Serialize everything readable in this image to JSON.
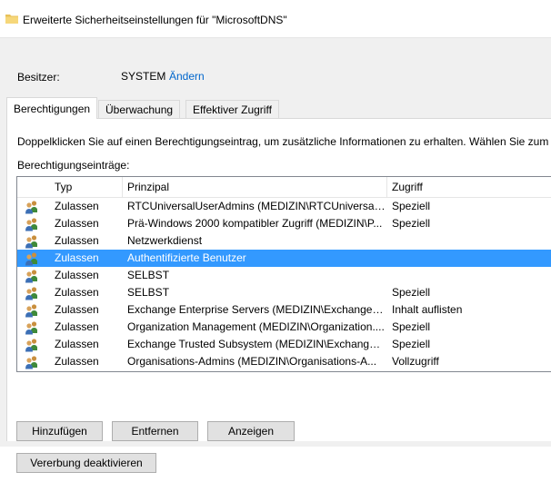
{
  "window": {
    "title": "Erweiterte Sicherheitseinstellungen für \"MicrosoftDNS\""
  },
  "owner": {
    "label": "Besitzer:",
    "value": "SYSTEM",
    "change_link": "Ändern"
  },
  "tabs": [
    {
      "label": "Berechtigungen",
      "active": true
    },
    {
      "label": "Überwachung",
      "active": false
    },
    {
      "label": "Effektiver Zugriff",
      "active": false
    }
  ],
  "permissions": {
    "info_text": "Doppelklicken Sie auf einen Berechtigungseintrag, um zusätzliche Informationen zu erhalten. Wählen Sie zum Ä",
    "entries_label": "Berechtigungseinträge:",
    "columns": {
      "typ": "Typ",
      "prinzipal": "Prinzipal",
      "zugriff": "Zugriff"
    },
    "rows": [
      {
        "typ": "Zulassen",
        "prinzipal": "RTCUniversalUserAdmins (MEDIZIN\\RTCUniversalU...",
        "zugriff": "Speziell",
        "selected": false
      },
      {
        "typ": "Zulassen",
        "prinzipal": "Prä-Windows 2000 kompatibler Zugriff (MEDIZIN\\P...",
        "zugriff": "Speziell",
        "selected": false
      },
      {
        "typ": "Zulassen",
        "prinzipal": "Netzwerkdienst",
        "zugriff": "",
        "selected": false
      },
      {
        "typ": "Zulassen",
        "prinzipal": "Authentifizierte Benutzer",
        "zugriff": "",
        "selected": true
      },
      {
        "typ": "Zulassen",
        "prinzipal": "SELBST",
        "zugriff": "",
        "selected": false
      },
      {
        "typ": "Zulassen",
        "prinzipal": "SELBST",
        "zugriff": "Speziell",
        "selected": false
      },
      {
        "typ": "Zulassen",
        "prinzipal": "Exchange Enterprise Servers (MEDIZIN\\Exchange En...",
        "zugriff": "Inhalt auflisten",
        "selected": false
      },
      {
        "typ": "Zulassen",
        "prinzipal": "Organization Management (MEDIZIN\\Organization....",
        "zugriff": "Speziell",
        "selected": false
      },
      {
        "typ": "Zulassen",
        "prinzipal": "Exchange Trusted Subsystem (MEDIZIN\\Exchange ...",
        "zugriff": "Speziell",
        "selected": false
      },
      {
        "typ": "Zulassen",
        "prinzipal": "Organisations-Admins (MEDIZIN\\Organisations-A...",
        "zugriff": "Vollzugriff",
        "selected": false
      }
    ],
    "row_icon": "user-group-icon"
  },
  "buttons": {
    "add": "Hinzufügen",
    "remove": "Entfernen",
    "view": "Anzeigen",
    "disable_inheritance": "Vererbung deaktivieren"
  },
  "colors": {
    "selection": "#3399ff",
    "link": "#0066cc",
    "dialog_bg": "#f0f0f0"
  }
}
